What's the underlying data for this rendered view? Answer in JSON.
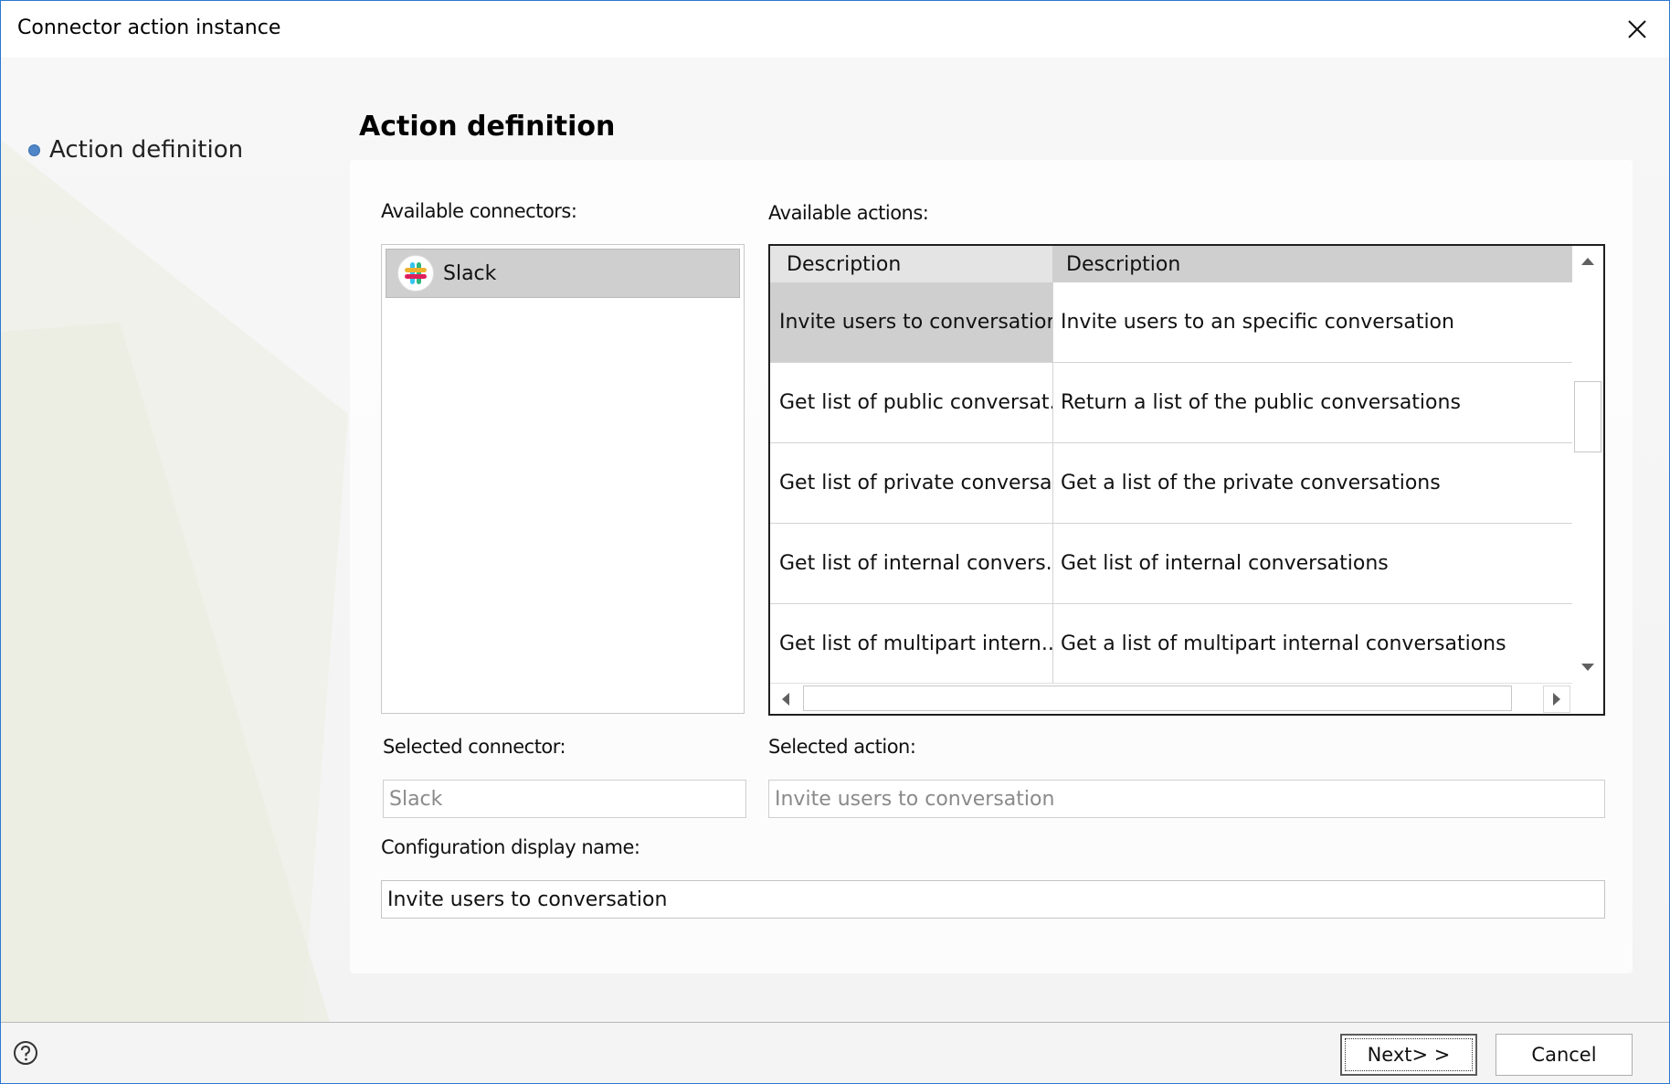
{
  "window": {
    "title": "Connector action instance"
  },
  "nav": {
    "items": [
      {
        "label": "Action definition"
      }
    ]
  },
  "page": {
    "title": "Action definition"
  },
  "connectors": {
    "label": "Available connectors:",
    "items": [
      {
        "label": "Slack",
        "icon": "slack-icon"
      }
    ]
  },
  "actions": {
    "label": "Available actions:",
    "columns": [
      "Description",
      "Description"
    ],
    "rows": [
      {
        "name": "Invite users to conversation",
        "description": "Invite users to an specific conversation",
        "selected": true
      },
      {
        "name": "Get list of public conversat...",
        "description": "Return a list of the public conversations"
      },
      {
        "name": "Get list of private conversa...",
        "description": "Get a list of the private conversations"
      },
      {
        "name": "Get list of internal convers...",
        "description": "Get list of internal conversations"
      },
      {
        "name": "Get list of multipart intern...",
        "description": "Get a list of multipart internal conversations"
      }
    ]
  },
  "selected_connector": {
    "label": "Selected connector:",
    "value": "Slack"
  },
  "selected_action": {
    "label": "Selected action:",
    "value": "Invite users to conversation"
  },
  "config_name": {
    "label": "Configuration display name:",
    "value": "Invite users to conversation"
  },
  "footer": {
    "next_label": "Next> >",
    "cancel_label": "Cancel"
  },
  "colors": {
    "accent": "#2b79d0",
    "selected_bg": "#cfcfcf",
    "bullet": "#4f86c8"
  }
}
